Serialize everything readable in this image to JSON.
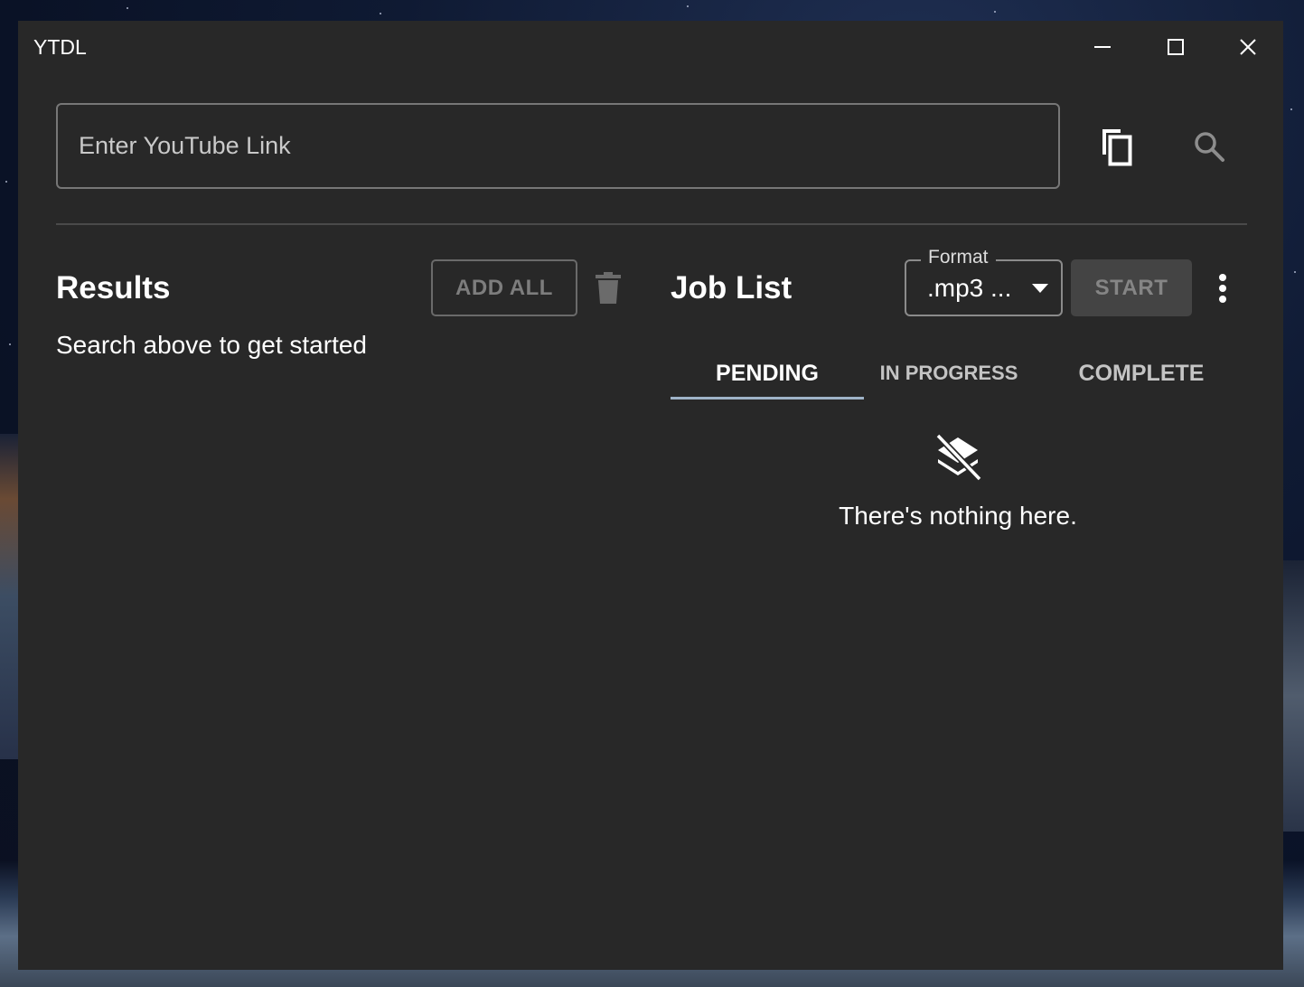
{
  "window": {
    "title": "YTDL",
    "controls": [
      "minimize-icon",
      "maximize-icon",
      "close-icon"
    ]
  },
  "search": {
    "placeholder": "Enter YouTube Link",
    "value": "",
    "paste_icon": "content-copy-icon",
    "search_icon": "search-icon"
  },
  "results": {
    "title": "Results",
    "add_all_label": "ADD ALL",
    "delete_icon": "trash-icon",
    "empty_message": "Search above to get started"
  },
  "jobs": {
    "title": "Job List",
    "format": {
      "label": "Format",
      "selected": ".mp3 ..."
    },
    "start_label": "START",
    "more_icon": "more-vert-icon",
    "tabs": [
      {
        "label": "PENDING",
        "active": true
      },
      {
        "label": "IN PROGRESS",
        "active": false
      },
      {
        "label": "COMPLETE",
        "active": false
      }
    ],
    "empty_icon": "layers-off-icon",
    "empty_message": "There's nothing here."
  },
  "colors": {
    "window_bg": "#282828",
    "text": "#ffffff",
    "tab_indicator": "#9fb3c8",
    "disabled_text": "#7d7d7d"
  }
}
